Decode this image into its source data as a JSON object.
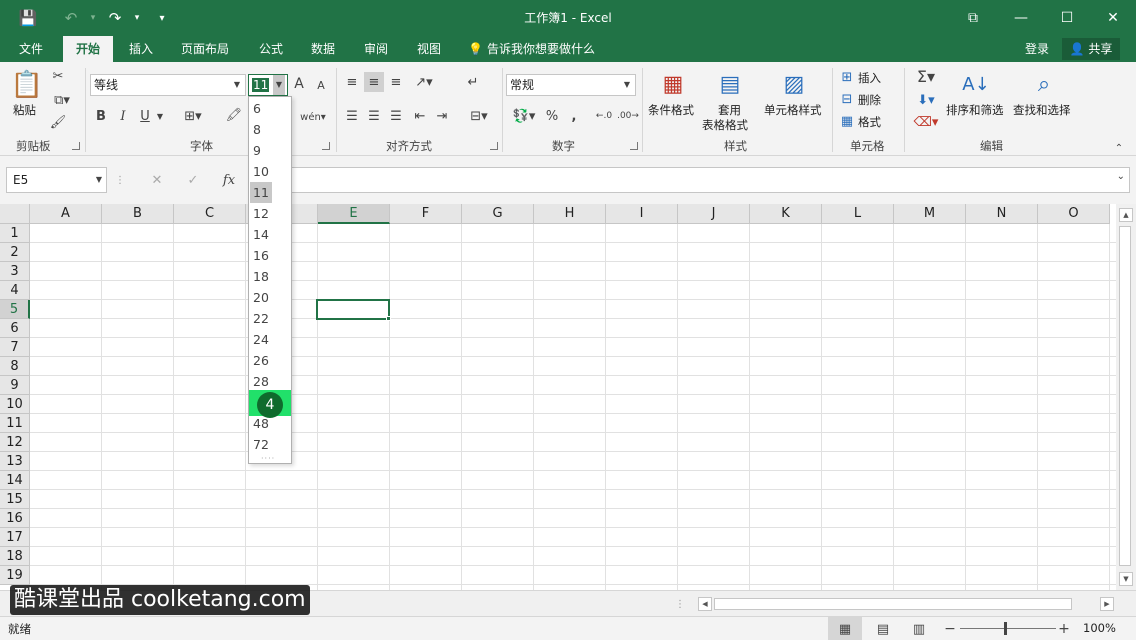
{
  "titlebar": {
    "title": "工作簿1 - Excel",
    "save_icon": "💾",
    "undo_icon": "↶",
    "redo_icon": "↷",
    "qat_icon": "▾",
    "ribbon_opts_icon": "⧉",
    "minimize": "—",
    "maximize": "☐",
    "close": "✕"
  },
  "tabs": [
    {
      "label": "文件"
    },
    {
      "label": "开始"
    },
    {
      "label": "插入"
    },
    {
      "label": "页面布局"
    },
    {
      "label": "公式"
    },
    {
      "label": "数据"
    },
    {
      "label": "审阅"
    },
    {
      "label": "视图"
    }
  ],
  "tellme": "告诉我你想要做什么",
  "login": "登录",
  "share": "共享",
  "ribbon": {
    "clipboard": {
      "paste": "粘贴",
      "label": "剪贴板"
    },
    "font": {
      "name": "等线",
      "size": "11",
      "bold": "B",
      "italic": "I",
      "underline": "U",
      "grow": "A",
      "shrink": "A",
      "label": "字体"
    },
    "alignment": {
      "label": "对齐方式"
    },
    "number": {
      "format": "常规",
      "percent": "%",
      "comma": ",",
      "label": "数字"
    },
    "styles": {
      "conditional": "条件格式",
      "table_line1": "套用",
      "table_line2": "表格格式",
      "cell_styles": "单元格样式",
      "label": "样式"
    },
    "cells": {
      "insert": "插入",
      "delete": "删除",
      "format": "格式",
      "label": "单元格"
    },
    "editing": {
      "sort": "排序和筛选",
      "find": "查找和选择",
      "label": "编辑"
    }
  },
  "formula_bar": {
    "name_box": "E5",
    "cancel": "✕",
    "enter": "✓",
    "fx": "fx"
  },
  "grid": {
    "columns": [
      "A",
      "B",
      "C",
      "D",
      "E",
      "F",
      "G",
      "H",
      "I",
      "J",
      "K",
      "L",
      "M",
      "N",
      "O"
    ],
    "rows": [
      "1",
      "2",
      "3",
      "4",
      "5",
      "6",
      "7",
      "8",
      "9",
      "10",
      "11",
      "12",
      "13",
      "14",
      "15",
      "16",
      "17",
      "18",
      "19"
    ],
    "selected_column": "E",
    "selected_row": "5"
  },
  "font_size_dropdown": {
    "items": [
      "6",
      "8",
      "9",
      "10",
      "11",
      "12",
      "14",
      "16",
      "18",
      "20",
      "22",
      "24",
      "26",
      "28",
      "4",
      "48",
      "72"
    ],
    "current": "11",
    "highlighted": "4"
  },
  "status": {
    "ready": "就绪",
    "zoom": "100%"
  },
  "watermark": "酷课堂出品 coolketang.com"
}
